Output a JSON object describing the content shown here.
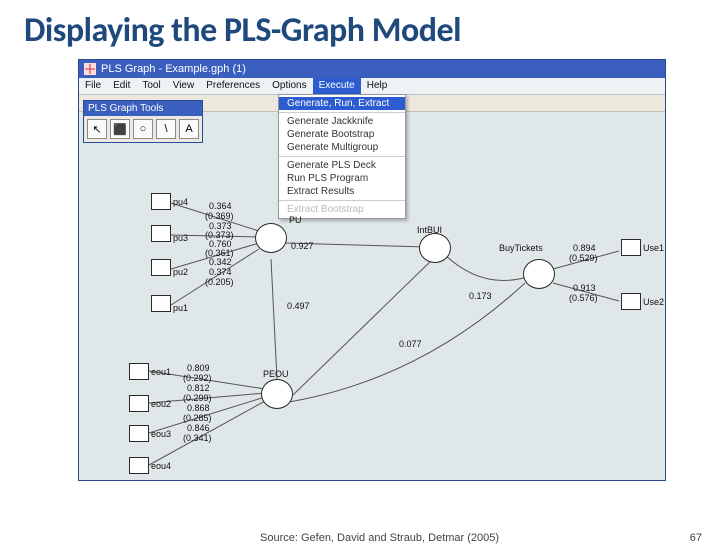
{
  "slide": {
    "title": "Displaying the PLS-Graph Model",
    "source": "Source: Gefen, David and Straub, Detmar (2005)",
    "page": "67"
  },
  "window": {
    "title": "PLS Graph - Example.gph (1)",
    "menus": [
      "File",
      "Edit",
      "Tool",
      "View",
      "Preferences",
      "Options",
      "Execute",
      "Help"
    ],
    "active_menu": "Execute"
  },
  "dropdown": {
    "sections": [
      [
        {
          "label": "Generate, Run, Extract",
          "highlight": true
        }
      ],
      [
        {
          "label": "Generate Jackknife"
        },
        {
          "label": "Generate Bootstrap"
        },
        {
          "label": "Generate Multigroup"
        }
      ],
      [
        {
          "label": "Generate PLS Deck"
        },
        {
          "label": "Run PLS Program"
        },
        {
          "label": "Extract Results"
        }
      ],
      [
        {
          "label": "Extract Bootstrap",
          "disabled": true
        }
      ]
    ]
  },
  "tools": {
    "title": "PLS Graph Tools",
    "buttons": [
      "↖",
      "⬛",
      "○",
      "\\",
      "A"
    ]
  },
  "nodes": {
    "manifest": {
      "pu4": "pu4",
      "pu3": "pu3",
      "pu2": "pu2",
      "pu1": "pu1",
      "eou1": "eou1",
      "eou2": "eou2",
      "eou3": "eou3",
      "eou4": "eou4",
      "Use1": "Use1",
      "Use2": "Use2"
    },
    "latent": {
      "PU": "PU",
      "PEOU": "PEOU",
      "Int": "IntBUI",
      "Buy": "BuyTickets"
    }
  },
  "values": {
    "pu4_a": "0.364",
    "pu4_b": "(0.369)",
    "pu3_a": "0.373",
    "pu3_b": "(0.373)",
    "pu3_c": "0.760",
    "pu3_d": "(0.361)",
    "pu2_a": "0.342",
    "pu2_b": "0.374",
    "pu2_c": "(0.205)",
    "pu2_d": "0.927",
    "c037": "0.497",
    "eou_a": "0.809",
    "eou_b": "(0.292)",
    "eou_c": "0.812",
    "eou_d": "(0.299)",
    "eou_e": "0.868",
    "eou_f": "(0.285)",
    "eou_g": "0.846",
    "eou_h": "(0.341)",
    "arc_0077": "0.077",
    "arc_0173": "0.173",
    "use1_a": "0.894",
    "use1_b": "(0.529)",
    "use2_a": "0.913",
    "use2_b": "(0.576)"
  }
}
